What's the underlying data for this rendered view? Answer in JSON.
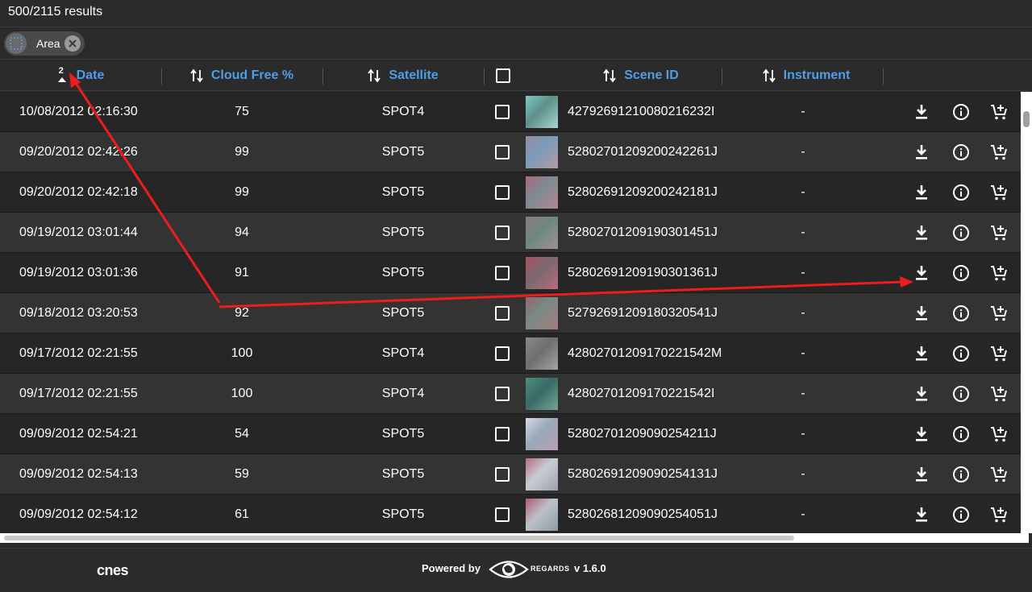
{
  "results_count": "500/2115 results",
  "filter_chip": {
    "label": "Area"
  },
  "columns": {
    "date": {
      "label": "Date",
      "sort_order": "2"
    },
    "cloud": {
      "label": "Cloud Free %"
    },
    "satellite": {
      "label": "Satellite"
    },
    "scene": {
      "label": "Scene ID"
    },
    "instrument": {
      "label": "Instrument"
    }
  },
  "rows": [
    {
      "date": "10/08/2012 02:16:30",
      "cloud": "75",
      "satellite": "SPOT4",
      "scene": "42792691210080216232I",
      "instrument": "-",
      "thumb": [
        "#7fc8c4",
        "#5e8f8a",
        "#a7d6d4"
      ]
    },
    {
      "date": "09/20/2012 02:42:26",
      "cloud": "99",
      "satellite": "SPOT5",
      "scene": "52802701209200242261J",
      "instrument": "-",
      "thumb": [
        "#9a8aa0",
        "#7a9cb8",
        "#b79aa5"
      ]
    },
    {
      "date": "09/20/2012 02:42:18",
      "cloud": "99",
      "satellite": "SPOT5",
      "scene": "52802691209200242181J",
      "instrument": "-",
      "thumb": [
        "#a86a7a",
        "#7d8a94",
        "#b98592"
      ]
    },
    {
      "date": "09/19/2012 03:01:44",
      "cloud": "94",
      "satellite": "SPOT5",
      "scene": "52802701209190301451J",
      "instrument": "-",
      "thumb": [
        "#8a7a80",
        "#6c8880",
        "#a29096"
      ]
    },
    {
      "date": "09/19/2012 03:01:36",
      "cloud": "91",
      "satellite": "SPOT5",
      "scene": "52802691209190301361J",
      "instrument": "-",
      "thumb": [
        "#a8505e",
        "#7a6a72",
        "#bb6b78"
      ]
    },
    {
      "date": "09/18/2012 03:20:53",
      "cloud": "92",
      "satellite": "SPOT5",
      "scene": "52792691209180320541J",
      "instrument": "-",
      "thumb": [
        "#8e6a6e",
        "#7a8a84",
        "#a67c80"
      ]
    },
    {
      "date": "09/17/2012 02:21:55",
      "cloud": "100",
      "satellite": "SPOT4",
      "scene": "42802701209170221542M",
      "instrument": "-",
      "thumb": [
        "#8a8a8a",
        "#6e6e6e",
        "#a3a3a3"
      ]
    },
    {
      "date": "09/17/2012 02:21:55",
      "cloud": "100",
      "satellite": "SPOT4",
      "scene": "42802701209170221542I",
      "instrument": "-",
      "thumb": [
        "#4e8e7e",
        "#3a6a66",
        "#6fa596"
      ]
    },
    {
      "date": "09/09/2012 02:54:21",
      "cloud": "54",
      "satellite": "SPOT5",
      "scene": "52802701209090254211J",
      "instrument": "-",
      "thumb": [
        "#d2dae4",
        "#9aa8ba",
        "#b8a0b0"
      ]
    },
    {
      "date": "09/09/2012 02:54:13",
      "cloud": "59",
      "satellite": "SPOT5",
      "scene": "52802691209090254131J",
      "instrument": "-",
      "thumb": [
        "#b46e80",
        "#c8ccd4",
        "#9aa0aa"
      ]
    },
    {
      "date": "09/09/2012 02:54:12",
      "cloud": "61",
      "satellite": "SPOT5",
      "scene": "52802681209090254051J",
      "instrument": "-",
      "thumb": [
        "#b2586c",
        "#bcc2ca",
        "#8e9aa2"
      ]
    }
  ],
  "footer": {
    "cnes": "cnes",
    "powered_by": "Powered by",
    "regards": "REGARDS",
    "version": "v 1.6.0"
  },
  "colors": {
    "accent": "#4e9eea",
    "annotation_arrow": "#ee1c1c"
  },
  "icons": {
    "row_actions": [
      "download-icon",
      "info-icon",
      "add-to-cart-icon"
    ],
    "chip": [
      "area-selection-icon",
      "close-icon"
    ],
    "header": [
      "sort-icon"
    ]
  }
}
